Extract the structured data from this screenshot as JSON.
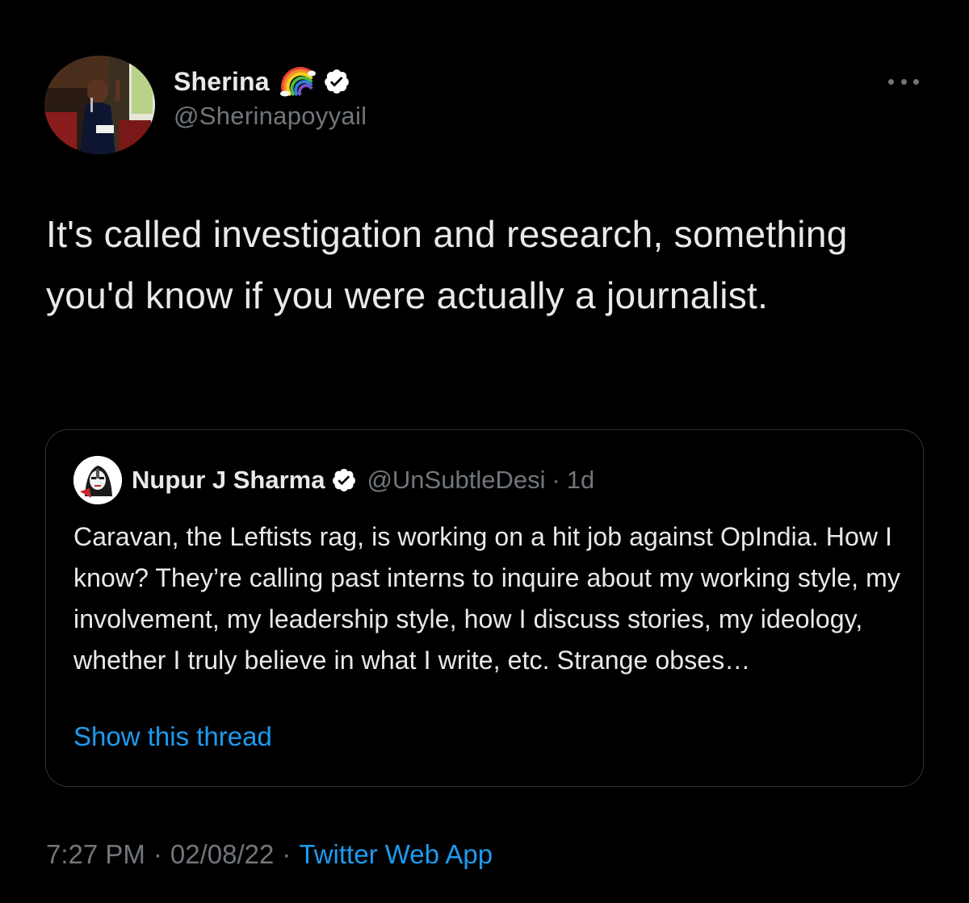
{
  "author": {
    "name": "Sherina",
    "handle": "@Sherinapoyyail",
    "badge_icons": [
      "rainbow-icon",
      "verified-icon"
    ]
  },
  "tweet": {
    "text": "It's called investigation and research, something you'd know if you were actually a journalist."
  },
  "quoted": {
    "name": "Nupur J Sharma",
    "handle": "@UnSubtleDesi",
    "separator": "·",
    "time": "1d",
    "text": "Caravan, the Leftists rag, is working on a hit job against OpIndia. How I know? They’re calling past interns to inquire about my working style, my involvement, my leadership style, how I discuss stories, my ideology, whether I truly believe in what I write, etc. Strange obses…",
    "show_thread": "Show this thread"
  },
  "meta": {
    "time": "7:27 PM",
    "date": "02/08/22",
    "separator": "·",
    "source": "Twitter Web App"
  },
  "colors": {
    "background": "#000000",
    "text": "#e7e9ea",
    "secondary": "#71767b",
    "link": "#1d9bf0",
    "border": "#2f3336",
    "verified": "#ffffff"
  }
}
